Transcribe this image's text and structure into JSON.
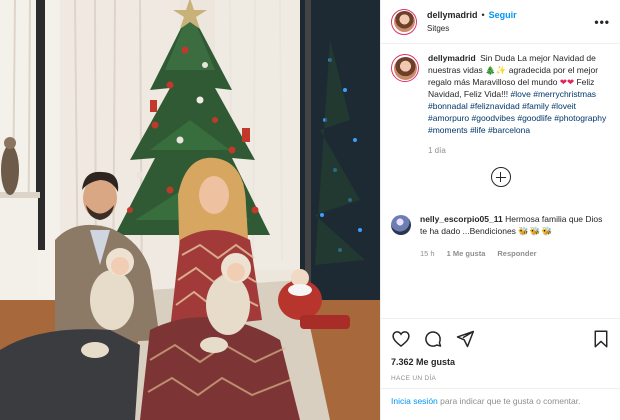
{
  "post": {
    "username": "dellymadrid",
    "follow_label": "Seguir",
    "location": "Sitges",
    "more_label": "•••"
  },
  "caption": {
    "username": "dellymadrid",
    "text_1": "Sin Duda La mejor Navidad de nuestras vidas",
    "tree_emoji": "🎄",
    "sparkle_emoji": "✨",
    "text_2": "agradecida por el mejor regalo más Maravilloso del mundo",
    "hearts": "❤❤",
    "text_3": "Feliz Navidad, Feliz Vida!!!",
    "hashtags": [
      "#love",
      "#merrychristmas",
      "#bonnadal",
      "#feliznavidad",
      "#family",
      "#loveit",
      "#amorpuro",
      "#goodvibes",
      "#goodlife",
      "#photography",
      "#moments",
      "#life",
      "#barcelona"
    ],
    "time": "1 día"
  },
  "comment": {
    "username": "nelly_escorpio05_11",
    "text": "Hermosa familia que Dios te ha dado ...Bendiciones",
    "emojis": "🐝🐝🐝",
    "time": "15 h",
    "likes": "1 Me gusta",
    "reply_label": "Responder"
  },
  "actions": {
    "like_icon": "heart-outline-icon",
    "comment_icon": "comment-bubble-icon",
    "share_icon": "paper-plane-icon",
    "save_icon": "bookmark-icon",
    "likes_count": "7.362 Me gusta",
    "posted_ago": "HACE UN DÍA"
  },
  "login": {
    "link_label": "Inicia sesión",
    "text": "para indicar que te gusta o comentar."
  },
  "colors": {
    "link_blue": "#0095f6",
    "hashtag_blue": "#00376b",
    "muted_gray": "#8e8e8e",
    "text_dark": "#262626"
  }
}
